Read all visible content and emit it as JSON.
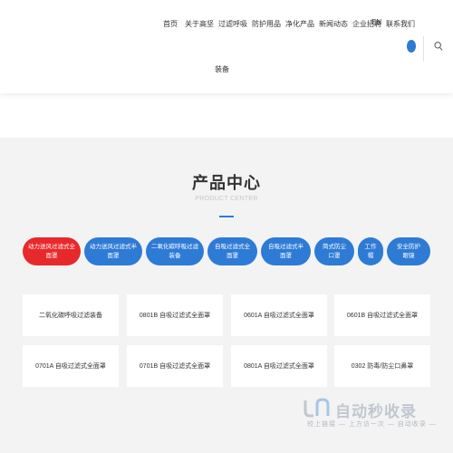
{
  "nav": {
    "items": [
      "首页",
      "关于高坚",
      "过滤呼吸",
      "防护用品",
      "净化产品",
      "新闻动态",
      "企业招聘",
      "联系我们"
    ],
    "lang": "EN",
    "sub_item": "装备"
  },
  "section": {
    "title": "产品中心",
    "subtitle": "PRODUCT CENTER"
  },
  "categories": [
    {
      "line1": "动力送风过滤式全",
      "line2": "面罩"
    },
    {
      "line1": "动力送风过滤式半",
      "line2": "面罩"
    },
    {
      "line1": "二氧化碳呼吸过滤",
      "line2": "装备"
    },
    {
      "line1": "自吸过滤式全",
      "line2": "面罩"
    },
    {
      "line1": "自吸过滤式半",
      "line2": "面罩"
    },
    {
      "line1": "简式防尘",
      "line2": "口罩"
    },
    {
      "line1": "工作",
      "line2": "帽"
    },
    {
      "line1": "安全防护",
      "line2": "眼镜"
    }
  ],
  "products": [
    "二氧化碳呼吸过滤装备",
    "0801B 自吸过滤式全面罩",
    "0601A 自吸过滤式全面罩",
    "0601B 自吸过滤式全面罩",
    "0701A 自吸过滤式全面罩",
    "0701B 自吸过滤式全面罩",
    "0801A 自吸过滤式全面罩",
    "0302 防毒/防尘口鼻罩"
  ],
  "watermark": {
    "main": "自动秒收录",
    "sub": "较上链接 — 上方访一次 — 自动收录 —"
  },
  "colors": {
    "accent_blue": "#2e7bd6",
    "active_red": "#e8292b",
    "section_bg": "#f3f3f3"
  }
}
